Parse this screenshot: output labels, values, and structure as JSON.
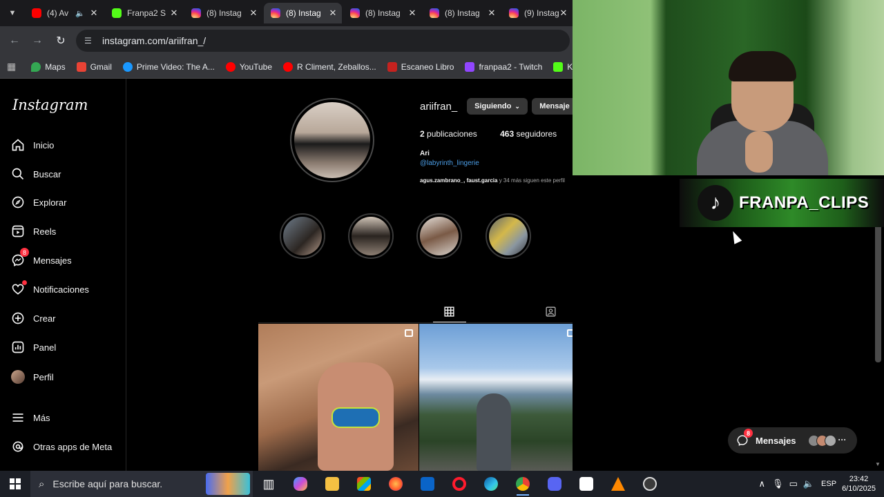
{
  "browser": {
    "tabs": [
      {
        "title": "(4) Av",
        "icon": "youtube",
        "muted": true
      },
      {
        "title": "Franpa2 S",
        "icon": "kick"
      },
      {
        "title": "(8) Instag",
        "icon": "instagram"
      },
      {
        "title": "(8) Instag",
        "icon": "instagram",
        "active": true
      },
      {
        "title": "(8) Instag",
        "icon": "instagram"
      },
      {
        "title": "(8) Instag",
        "icon": "instagram"
      },
      {
        "title": "(9) Instag",
        "icon": "instagram"
      }
    ],
    "url": "instagram.com/ariifran_/",
    "bookmarks": [
      {
        "label": "Maps",
        "color": "#34a853"
      },
      {
        "label": "Gmail",
        "color": "#ea4335"
      },
      {
        "label": "Prime Video: The A...",
        "color": "#1a98ff"
      },
      {
        "label": "YouTube",
        "color": "#ff0000"
      },
      {
        "label": "R Climent, Zeballos...",
        "color": "#ff0000"
      },
      {
        "label": "Escaneo Libro",
        "color": "#c5221f"
      },
      {
        "label": "franpaa2 - Twitch",
        "color": "#9146ff"
      },
      {
        "label": "Kick",
        "color": "#53fc18"
      }
    ]
  },
  "sidebar": {
    "logo": "Instagram",
    "items": [
      {
        "label": "Inicio",
        "icon": "home-icon"
      },
      {
        "label": "Buscar",
        "icon": "search-icon"
      },
      {
        "label": "Explorar",
        "icon": "compass-icon"
      },
      {
        "label": "Reels",
        "icon": "reels-icon"
      },
      {
        "label": "Mensajes",
        "icon": "messenger-icon",
        "badge": "8"
      },
      {
        "label": "Notificaciones",
        "icon": "heart-icon",
        "dot": true
      },
      {
        "label": "Crear",
        "icon": "plus-icon"
      },
      {
        "label": "Panel",
        "icon": "dashboard-icon"
      },
      {
        "label": "Perfil",
        "icon": "avatar-icon"
      },
      {
        "label": "Más",
        "icon": "menu-icon"
      },
      {
        "label": "Otras apps de Meta",
        "icon": "threads-icon"
      }
    ]
  },
  "profile": {
    "username": "ariifran_",
    "following_btn": "Siguiendo",
    "message_btn": "Mensaje",
    "posts_count": "2",
    "posts_label": "publicaciones",
    "followers_count": "463",
    "followers_label": "seguidores",
    "name": "Ari",
    "bio_link": "@labyrinth_lingerie",
    "followed_by_users": "agus.zambrano_, faust.garcia",
    "followed_by_rest": " y 34 más siguen este perfil"
  },
  "floating": {
    "messages_label": "Mensajes",
    "messages_badge": "8"
  },
  "overlay": {
    "brand": "FRANPA_CLIPS"
  },
  "taskbar": {
    "search_placeholder": "Escribe aquí para buscar.",
    "language": "ESP",
    "time": "23:42",
    "date": "6/10/2025"
  }
}
